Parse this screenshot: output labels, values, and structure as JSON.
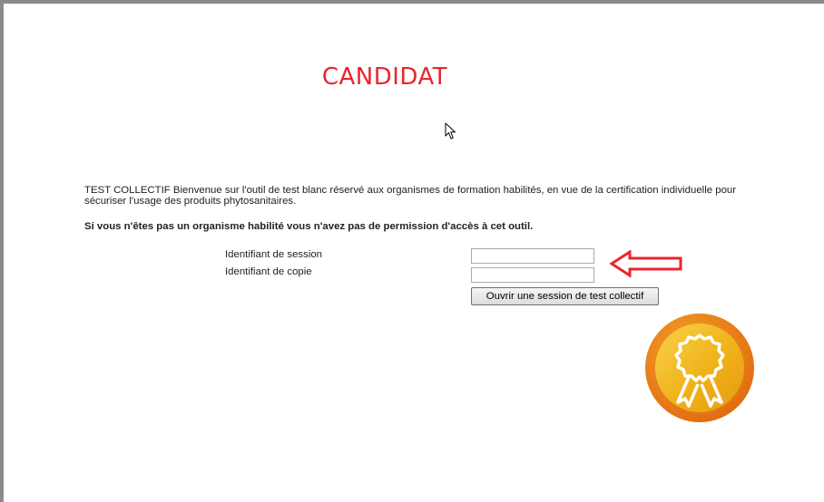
{
  "page": {
    "title": "CANDIDAT",
    "intro_text": "TEST COLLECTIF Bienvenue sur l'outil de test blanc réservé aux organismes de formation habilités, en vue de la certification individuelle pour sécuriser l'usage des produits phytosanitaires.",
    "warning_text": "Si vous n'êtes pas un organisme habilité vous n'avez pas de permission d'accès à cet outil."
  },
  "form": {
    "session_label": "Identifiant de session",
    "session_value": "",
    "copy_label": "Identifiant de copie",
    "copy_value": "",
    "submit_label": "Ouvrir une session de test collectif"
  },
  "icons": {
    "cursor": "mouse-pointer-icon",
    "arrow": "red-arrow-icon",
    "badge": "award-ribbon-icon"
  },
  "colors": {
    "title": "#e8262d",
    "arrow": "#e8262d",
    "badge_outer": "#ee7a1a",
    "badge_inner": "#f3b51a"
  }
}
